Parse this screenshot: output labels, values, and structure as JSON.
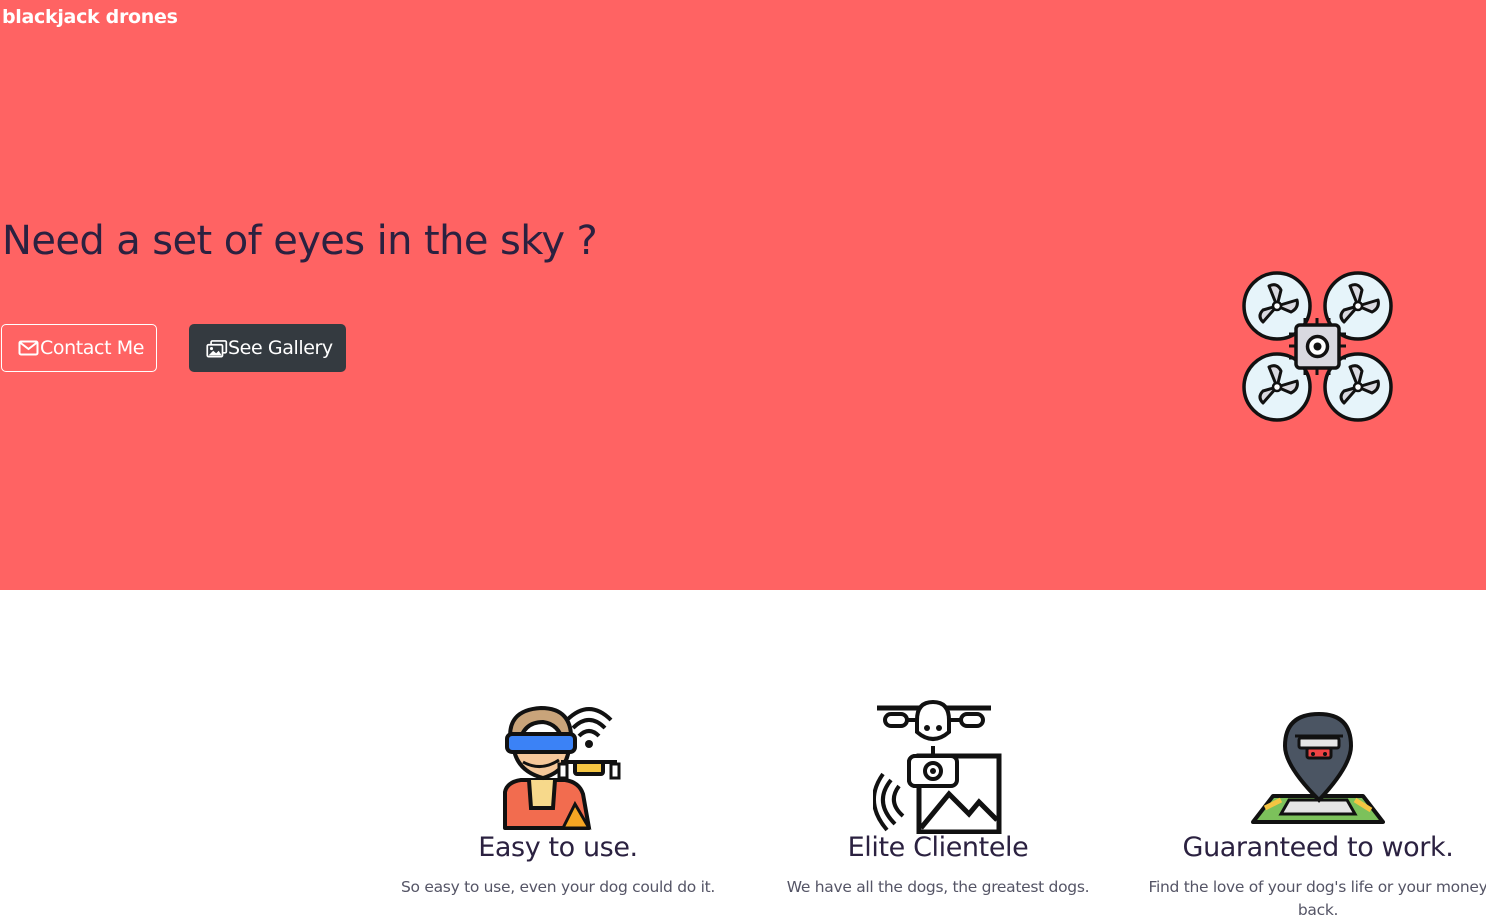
{
  "brand": "blackjack drones",
  "hero": {
    "headline": "Need a set of eyes in the sky ?",
    "contact_label": "Contact Me",
    "gallery_label": "See Gallery",
    "background": "#ff6363"
  },
  "features": [
    {
      "title": "Easy to use.",
      "text": "So easy to use, even your dog could do it.",
      "icon": "drone-pilot-icon"
    },
    {
      "title": "Elite Clientele",
      "text": "We have all the dogs, the greatest dogs.",
      "icon": "camera-drone-icon"
    },
    {
      "title": "Guaranteed to work.",
      "text": "Find the love of your dog's life or your money back.",
      "icon": "drone-location-pin-icon"
    }
  ],
  "colors": {
    "hero_bg": "#ff6363",
    "heading": "#2b2140",
    "dark_button": "#343a40"
  }
}
